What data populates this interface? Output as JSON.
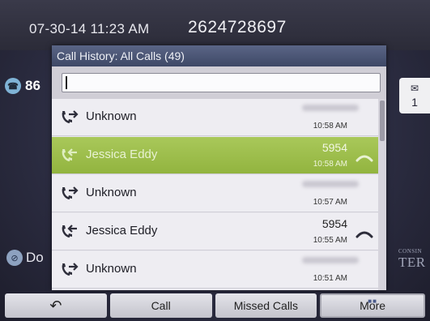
{
  "status": {
    "datetime": "07-30-14 11:23 AM",
    "phone_number": "2624728697"
  },
  "background": {
    "line_label": "86",
    "dnd_label": "Do",
    "message_count": "1",
    "logo_small": "CONSIN",
    "logo_big": "TER"
  },
  "popup": {
    "title": "Call History: All Calls (49)",
    "search_value": ""
  },
  "calls": [
    {
      "direction": "outgoing",
      "name": "Unknown",
      "ext": "",
      "time": "10:58 AM",
      "has_handset": false,
      "selected": false
    },
    {
      "direction": "incoming",
      "name": "Jessica Eddy",
      "ext": "5954",
      "time": "10:58 AM",
      "has_handset": true,
      "selected": true
    },
    {
      "direction": "outgoing",
      "name": "Unknown",
      "ext": "",
      "time": "10:57 AM",
      "has_handset": false,
      "selected": false
    },
    {
      "direction": "incoming",
      "name": "Jessica Eddy",
      "ext": "5954",
      "time": "10:55 AM",
      "has_handset": true,
      "selected": false
    },
    {
      "direction": "outgoing",
      "name": "Unknown",
      "ext": "",
      "time": "10:51 AM",
      "has_handset": false,
      "selected": false
    }
  ],
  "softkeys": {
    "back_label": "↶",
    "call_label": "Call",
    "missed_label": "Missed Calls",
    "more_label": "More"
  },
  "colors": {
    "accent_green": "#9bbc4a",
    "header_blue": "#4a5576"
  }
}
